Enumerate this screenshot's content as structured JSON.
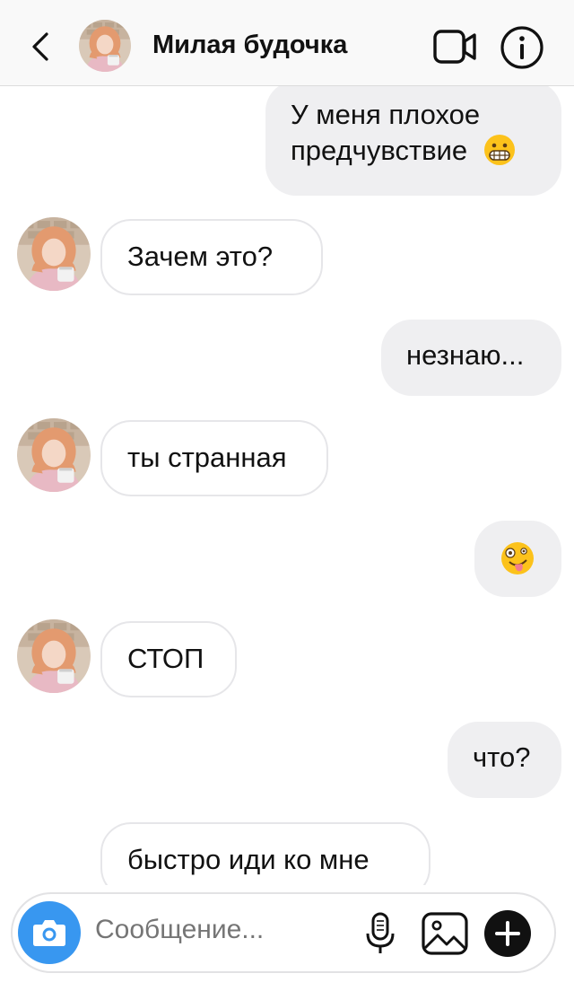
{
  "header": {
    "title": "Милая будочка"
  },
  "messages": [
    {
      "side": "out",
      "line1": "У меня плохое",
      "line2": "предчувствие",
      "emoji": "grimace"
    },
    {
      "side": "in",
      "text": "Зачем это?"
    },
    {
      "side": "out",
      "text": "незнаю..."
    },
    {
      "side": "in",
      "text": "ты странная"
    },
    {
      "side": "out",
      "emoji": "zany"
    },
    {
      "side": "in",
      "text": "СТОП"
    },
    {
      "side": "out",
      "text": "что?"
    },
    {
      "side": "in",
      "text": "быстро иди ко мне"
    }
  ],
  "composer": {
    "placeholder": "Сообщение..."
  },
  "icons": {
    "back": "chevron-left-icon",
    "video": "video-camera-icon",
    "info": "info-icon",
    "camera": "camera-icon",
    "mic": "microphone-icon",
    "gallery": "image-icon",
    "plus": "plus-icon"
  },
  "colors": {
    "accent": "#3897f0",
    "outgoing_bubble": "#efeff1",
    "incoming_border": "#e6e6e9",
    "placeholder": "#a9a9ad"
  }
}
